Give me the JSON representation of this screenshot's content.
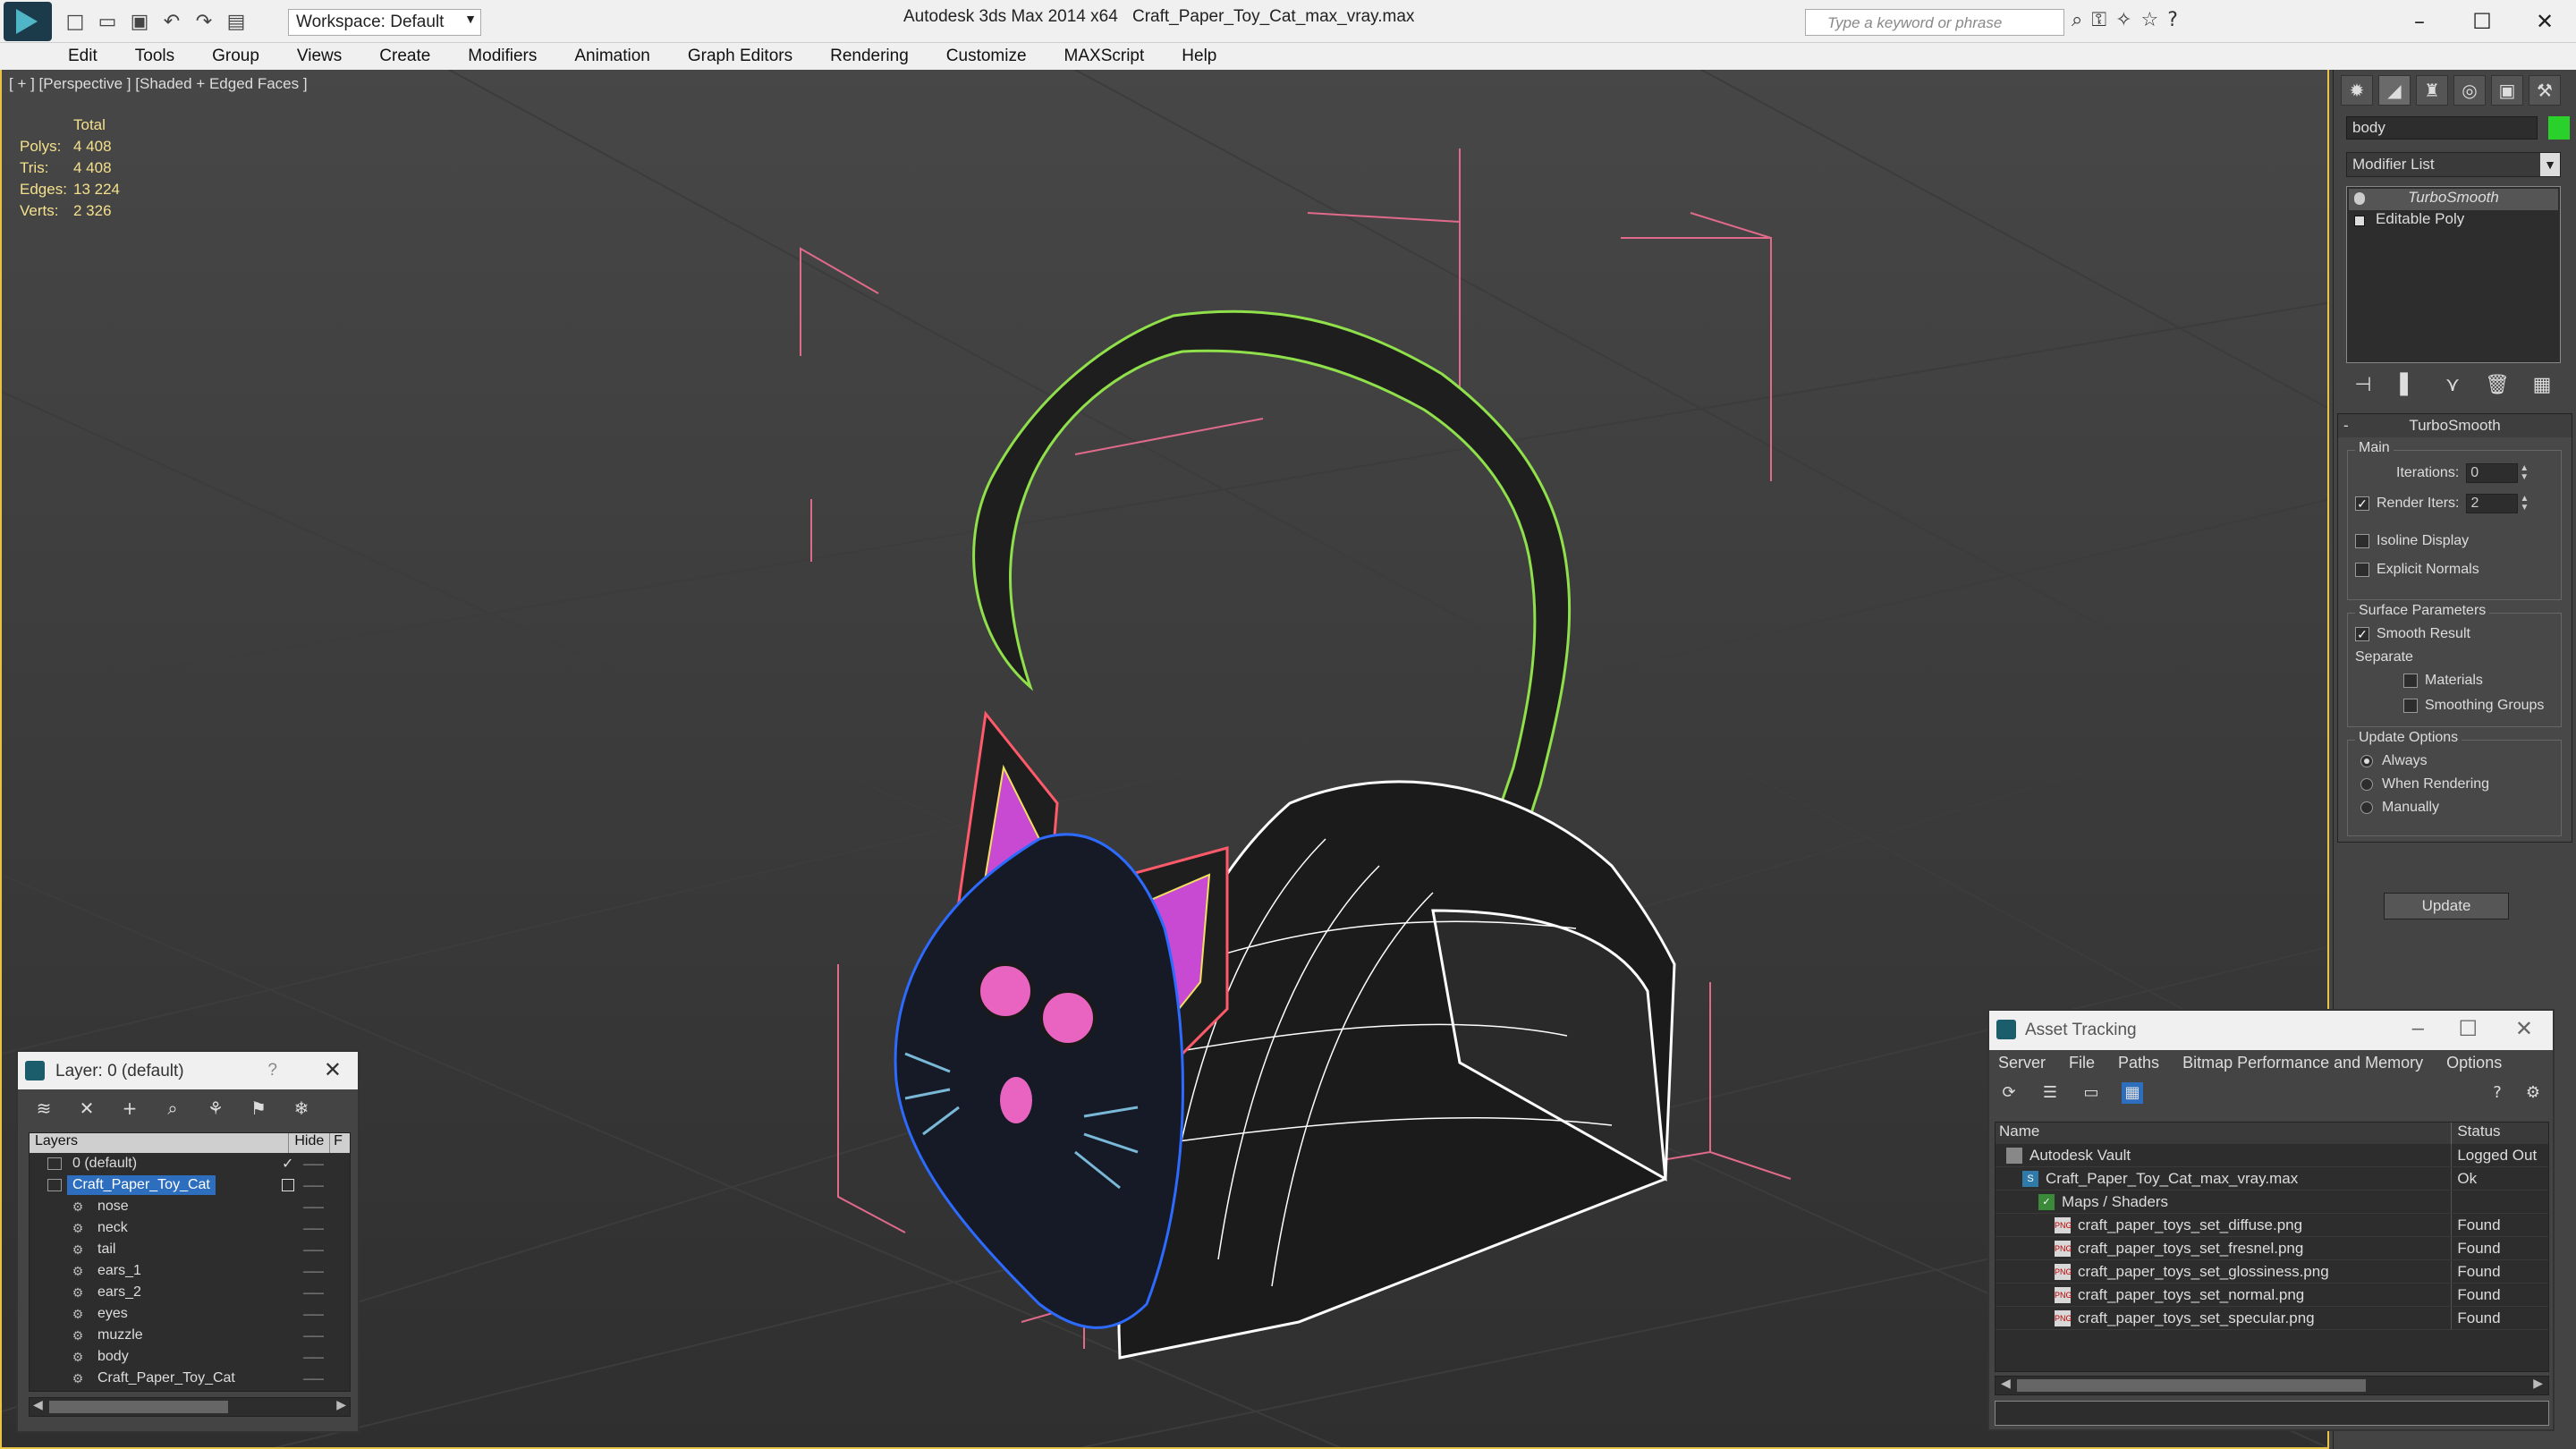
{
  "titlebar": {
    "workspace": "Workspace: Default",
    "app_title": "Autodesk 3ds Max  2014 x64",
    "file_title": "Craft_Paper_Toy_Cat_max_vray.max",
    "search_placeholder": "Type a keyword or phrase"
  },
  "menu": [
    "Edit",
    "Tools",
    "Group",
    "Views",
    "Create",
    "Modifiers",
    "Animation",
    "Graph Editors",
    "Rendering",
    "Customize",
    "MAXScript",
    "Help"
  ],
  "viewport": {
    "label": "[ + ] [Perspective ] [Shaded + Edged Faces ]",
    "stats": {
      "total_label": "Total",
      "rows": [
        {
          "label": "Polys:",
          "value": "4 408"
        },
        {
          "label": "Tris:",
          "value": "4 408"
        },
        {
          "label": "Edges:",
          "value": "13 224"
        },
        {
          "label": "Verts:",
          "value": "2 326"
        }
      ]
    }
  },
  "command_panel": {
    "object_name": "body",
    "object_color": "#2bd12b",
    "modifier_list": "Modifier List",
    "stack": [
      "TurboSmooth",
      "Editable Poly"
    ],
    "turbosmooth": {
      "title": "TurboSmooth",
      "main_label": "Main",
      "iterations_label": "Iterations:",
      "iterations_value": "0",
      "render_iters_label": "Render Iters:",
      "render_iters_value": "2",
      "isoline": "Isoline Display",
      "explicit_normals": "Explicit Normals",
      "surface_params": "Surface Parameters",
      "smooth_result": "Smooth Result",
      "separate": "Separate",
      "materials": "Materials",
      "smoothing_groups": "Smoothing Groups",
      "update_options": "Update Options",
      "always": "Always",
      "when_rendering": "When Rendering",
      "manually": "Manually",
      "update_button": "Update"
    }
  },
  "layer_dialog": {
    "title": "Layer: 0 (default)",
    "help": "?",
    "col_layers": "Layers",
    "col_hide": "Hide",
    "col_f": "F",
    "rows": [
      {
        "name": "0 (default)",
        "level": 1
      },
      {
        "name": "Craft_Paper_Toy_Cat",
        "level": 1
      },
      {
        "name": "nose",
        "level": 2
      },
      {
        "name": "neck",
        "level": 2
      },
      {
        "name": "tail",
        "level": 2
      },
      {
        "name": "ears_1",
        "level": 2
      },
      {
        "name": "ears_2",
        "level": 2
      },
      {
        "name": "eyes",
        "level": 2
      },
      {
        "name": "muzzle",
        "level": 2
      },
      {
        "name": "body",
        "level": 2
      },
      {
        "name": "Craft_Paper_Toy_Cat",
        "level": 2
      }
    ]
  },
  "asset_tracking": {
    "title": "Asset Tracking",
    "menu": [
      "Server",
      "File",
      "Paths",
      "Bitmap Performance and Memory",
      "Options"
    ],
    "col_name": "Name",
    "col_status": "Status",
    "rows": [
      {
        "name": "Autodesk Vault",
        "status": "Logged Out",
        "icon": "vault"
      },
      {
        "name": "Craft_Paper_Toy_Cat_max_vray.max",
        "status": "Ok",
        "icon": "max"
      },
      {
        "name": "Maps / Shaders",
        "status": "",
        "icon": "maps"
      },
      {
        "name": "craft_paper_toys_set_diffuse.png",
        "status": "Found",
        "icon": "png"
      },
      {
        "name": "craft_paper_toys_set_fresnel.png",
        "status": "Found",
        "icon": "png"
      },
      {
        "name": "craft_paper_toys_set_glossiness.png",
        "status": "Found",
        "icon": "png"
      },
      {
        "name": "craft_paper_toys_set_normal.png",
        "status": "Found",
        "icon": "png"
      },
      {
        "name": "craft_paper_toys_set_specular.png",
        "status": "Found",
        "icon": "png"
      }
    ]
  }
}
